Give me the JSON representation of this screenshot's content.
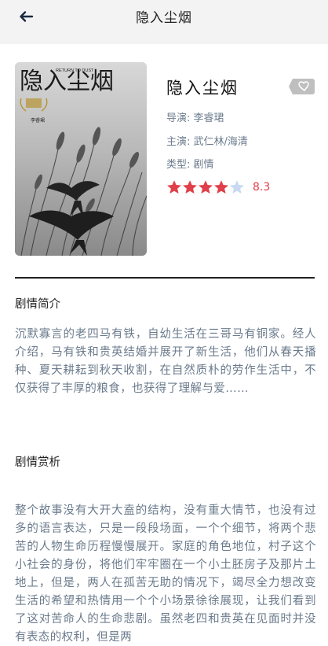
{
  "header": {
    "title": "隐入尘烟",
    "back_icon": "arrow-left-icon"
  },
  "poster": {
    "title_cn": "隐入尘烟",
    "title_en": "RETURN TO DUST",
    "director_tag": "李睿珺"
  },
  "movie": {
    "title": "隐入尘烟",
    "director": "导演: 李睿珺",
    "cast": "主演: 武仁林/海清",
    "genre": "类型: 剧情",
    "rating": 4,
    "rating_max": 5,
    "score": "8.3",
    "star_filled_color": "#e0404a",
    "star_empty_color": "#c9d9f2",
    "favorite_icon": "heart-icon"
  },
  "sections": {
    "synopsis_heading": "剧情简介",
    "synopsis_text": "沉默寡言的老四马有铁，自幼生活在三哥马有铜家。经人介绍，马有铁和贵英结婚并展开了新生活，他们从春天播种、夏天耕耘到秋天收割，在自然质朴的劳作生活中，不仅获得了丰厚的粮食，也获得了理解与爱……",
    "analysis_heading": "剧情赏析",
    "analysis_text": "整个故事没有大开大盍的结构，没有重大情节，也没有过多的语言表达，只是一段段场面，一个个细节，将两个悲苦的人物生命历程慢慢展开。家庭的角色地位，村子这个小社会的身份，将他们牢牢圈在一个小土胚房子及那片土地上，但是，两人在孤苦无助的情况下，竭尽全力想改变生活的希望和热情用一个个小场景徐徐展现，让我们看到了这对苦命人的生命悲剧。虽然老四和贵英在见面时并没有表态的权利，但是两"
  }
}
